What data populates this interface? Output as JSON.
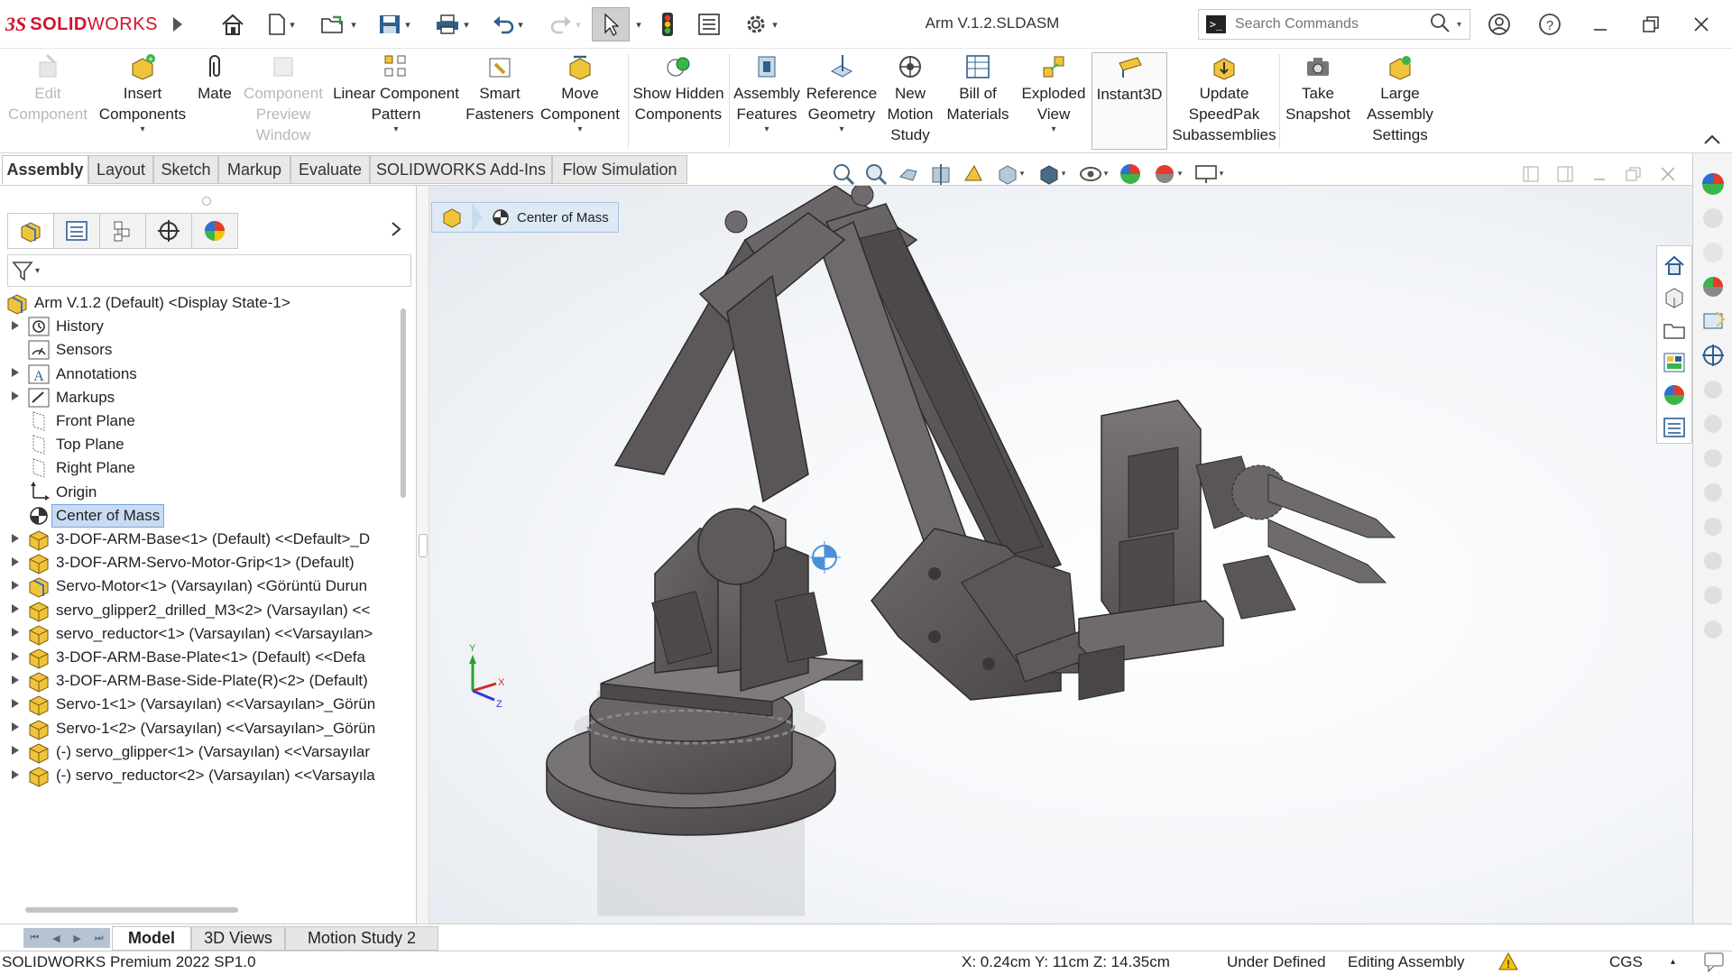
{
  "app": {
    "brand_ds": "3S",
    "brand_solid": "SOLID",
    "brand_works": "WORKS",
    "title": "Arm V.1.2.SLDASM"
  },
  "search": {
    "placeholder": "Search Commands"
  },
  "ribbon": {
    "buttons": [
      {
        "label": "Edit Component",
        "enabled": false
      },
      {
        "label": "Insert Components",
        "enabled": true,
        "dropdown": true
      },
      {
        "label": "Mate",
        "enabled": true
      },
      {
        "label": "Component Preview Window",
        "enabled": false
      },
      {
        "label": "Linear Component Pattern",
        "enabled": true,
        "dropdown": true
      },
      {
        "label": "Smart Fasteners",
        "enabled": true
      },
      {
        "label": "Move Component",
        "enabled": true,
        "dropdown": true
      },
      {
        "label": "Show Hidden Components",
        "enabled": true
      },
      {
        "label": "Assembly Features",
        "enabled": true,
        "dropdown": true
      },
      {
        "label": "Reference Geometry",
        "enabled": true,
        "dropdown": true
      },
      {
        "label": "New Motion Study",
        "enabled": true
      },
      {
        "label": "Bill of Materials",
        "enabled": true
      },
      {
        "label": "Exploded View",
        "enabled": true,
        "dropdown": true
      },
      {
        "label": "Instant3D",
        "enabled": true,
        "active": true
      },
      {
        "label": "Update SpeedPak Subassemblies",
        "enabled": true
      },
      {
        "label": "Take Snapshot",
        "enabled": true
      },
      {
        "label": "Large Assembly Settings",
        "enabled": true
      }
    ]
  },
  "tabs": [
    "Assembly",
    "Layout",
    "Sketch",
    "Markup",
    "Evaluate",
    "SOLIDWORKS Add-Ins",
    "Flow Simulation"
  ],
  "active_tab": "Assembly",
  "breadcrumb": {
    "label": "Center of Mass"
  },
  "tree": {
    "root": "Arm V.1.2 (Default) <Display State-1>",
    "items": [
      {
        "label": "History",
        "expandable": true,
        "icon": "history-icon"
      },
      {
        "label": "Sensors",
        "expandable": false,
        "icon": "sensor-icon"
      },
      {
        "label": "Annotations",
        "expandable": true,
        "icon": "annotation-icon"
      },
      {
        "label": "Markups",
        "expandable": true,
        "icon": "markup-icon"
      },
      {
        "label": "Front Plane",
        "expandable": false,
        "icon": "plane-icon"
      },
      {
        "label": "Top Plane",
        "expandable": false,
        "icon": "plane-icon"
      },
      {
        "label": "Right Plane",
        "expandable": false,
        "icon": "plane-icon"
      },
      {
        "label": "Origin",
        "expandable": false,
        "icon": "origin-icon"
      },
      {
        "label": "Center of Mass",
        "expandable": false,
        "icon": "center-of-mass-icon",
        "selected": true
      },
      {
        "label": "3-DOF-ARM-Base<1> (Default) <<Default>_D",
        "expandable": true,
        "icon": "subassembly-icon"
      },
      {
        "label": "3-DOF-ARM-Servo-Motor-Grip<1> (Default)",
        "expandable": true,
        "icon": "subassembly-icon"
      },
      {
        "label": "Servo-Motor<1> (Varsayılan) <Görüntü Durun",
        "expandable": true,
        "icon": "assembly-icon"
      },
      {
        "label": "servo_glipper2_drilled_M3<2> (Varsayılan) <<",
        "expandable": true,
        "icon": "subassembly-icon"
      },
      {
        "label": "servo_reductor<1> (Varsayılan) <<Varsayılan>",
        "expandable": true,
        "icon": "subassembly-icon"
      },
      {
        "label": "3-DOF-ARM-Base-Plate<1> (Default) <<Defa",
        "expandable": true,
        "icon": "subassembly-icon"
      },
      {
        "label": "3-DOF-ARM-Base-Side-Plate(R)<2> (Default)",
        "expandable": true,
        "icon": "subassembly-icon"
      },
      {
        "label": "Servo-1<1> (Varsayılan) <<Varsayılan>_Görün",
        "expandable": true,
        "icon": "subassembly-icon"
      },
      {
        "label": "Servo-1<2> (Varsayılan) <<Varsayılan>_Görün",
        "expandable": true,
        "icon": "subassembly-icon"
      },
      {
        "label": "(-) servo_glipper<1> (Varsayılan) <<Varsayılar",
        "expandable": true,
        "icon": "subassembly-icon"
      },
      {
        "label": "(-) servo_reductor<2> (Varsayılan) <<Varsayıla",
        "expandable": true,
        "icon": "subassembly-icon"
      }
    ]
  },
  "model_tabs": [
    "Model",
    "3D Views",
    "Motion Study 2"
  ],
  "active_model_tab": "Model",
  "status": {
    "product": "SOLIDWORKS Premium 2022 SP1.0",
    "coords": "X: 0.24cm Y: 11cm Z: 14.35cm",
    "definition": "Under Defined",
    "mode": "Editing Assembly",
    "units": "CGS"
  },
  "triad": {
    "x": "X",
    "y": "Y",
    "z": "Z"
  },
  "colors": {
    "brand": "#d3122d",
    "selection": "#c8dbf2",
    "model": "#5e5a5c"
  }
}
